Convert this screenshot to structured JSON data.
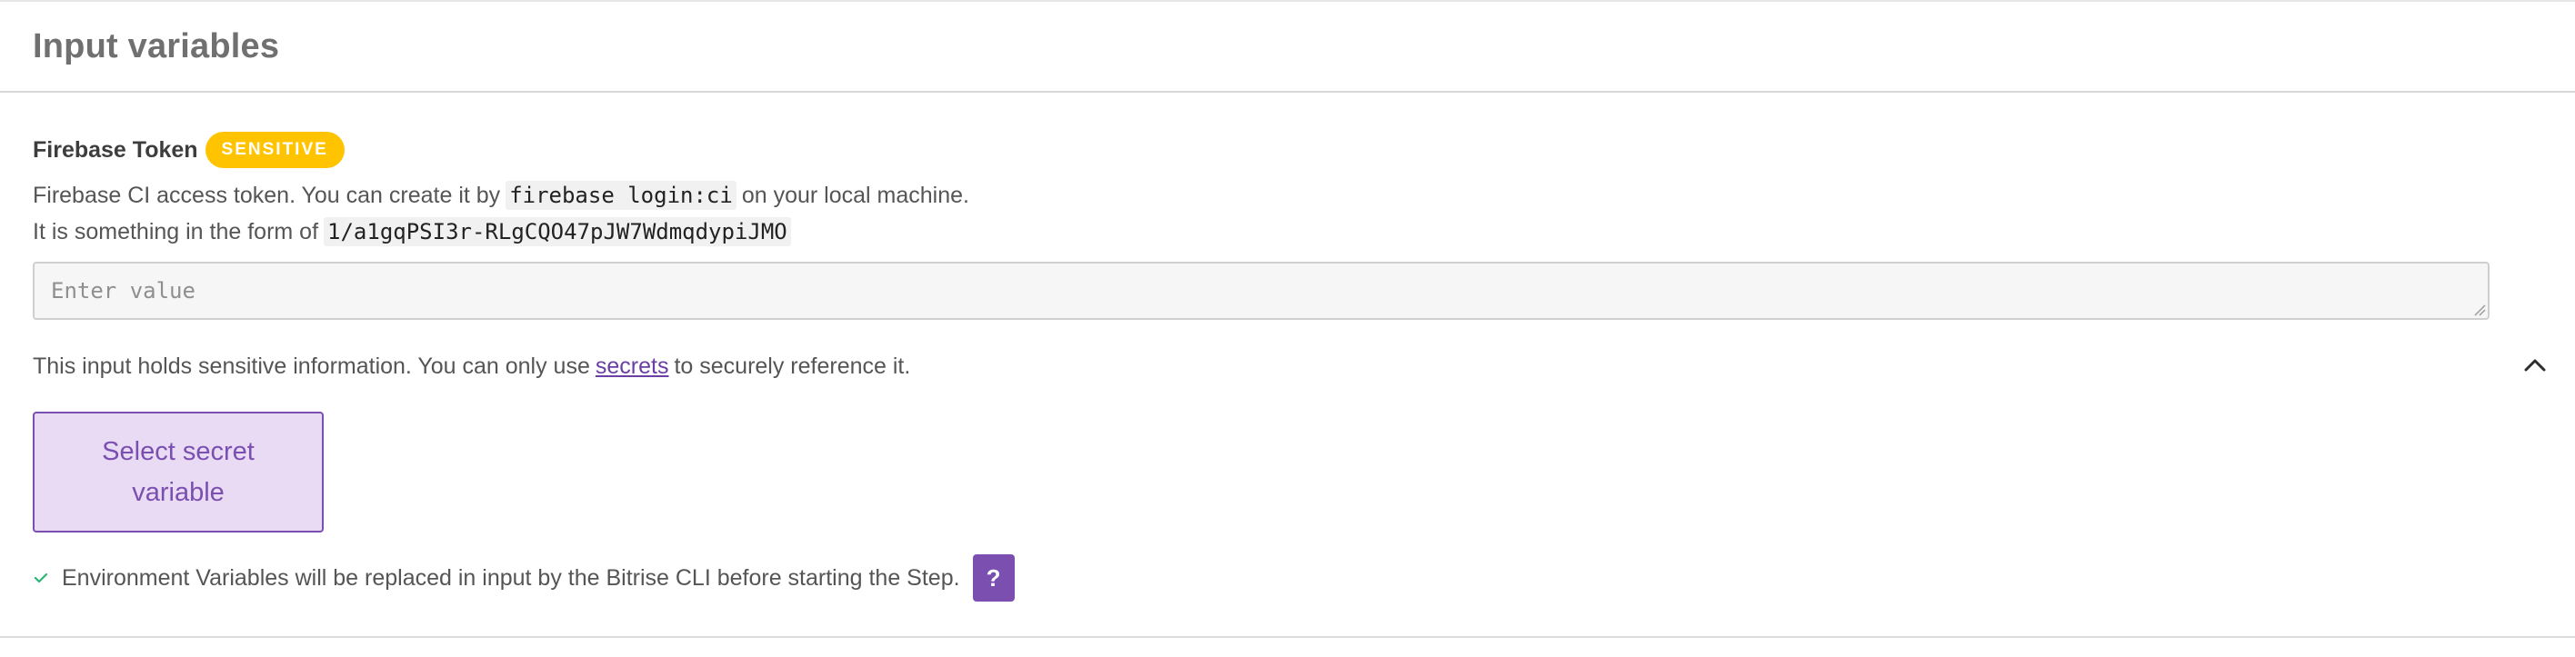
{
  "section": {
    "title": "Input variables"
  },
  "field": {
    "label": "Firebase Token",
    "badge": "SENSITIVE",
    "description_line1_before": "Firebase CI access token. You can create it by",
    "description_line1_code": "firebase login:ci",
    "description_line1_after": "on your local machine.",
    "description_line2_before": "It is something in the form of",
    "description_line2_code": "1/a1gqPSI3r-RLgCQO47pJW7WdmqdypiJMO",
    "input_value": "",
    "input_placeholder": "Enter value"
  },
  "sensitive_note": {
    "before": "This input holds sensitive information. You can only use",
    "link": "secrets",
    "after": "to securely reference it."
  },
  "secret_button": {
    "label": "Select secret variable"
  },
  "env_note": {
    "text": "Environment Variables will be replaced in input by the Bitrise CLI before starting the Step.",
    "help_label": "?"
  },
  "colors": {
    "badge": "#ffc300",
    "accent_purple": "#7a4fb0",
    "button_fill": "#e9dbf4",
    "check_green": "#2bb673",
    "link": "#6a3fa3"
  },
  "icons": {
    "collapse": "chevron-up-icon",
    "check": "check-icon",
    "resize": "resize-grip-icon"
  }
}
